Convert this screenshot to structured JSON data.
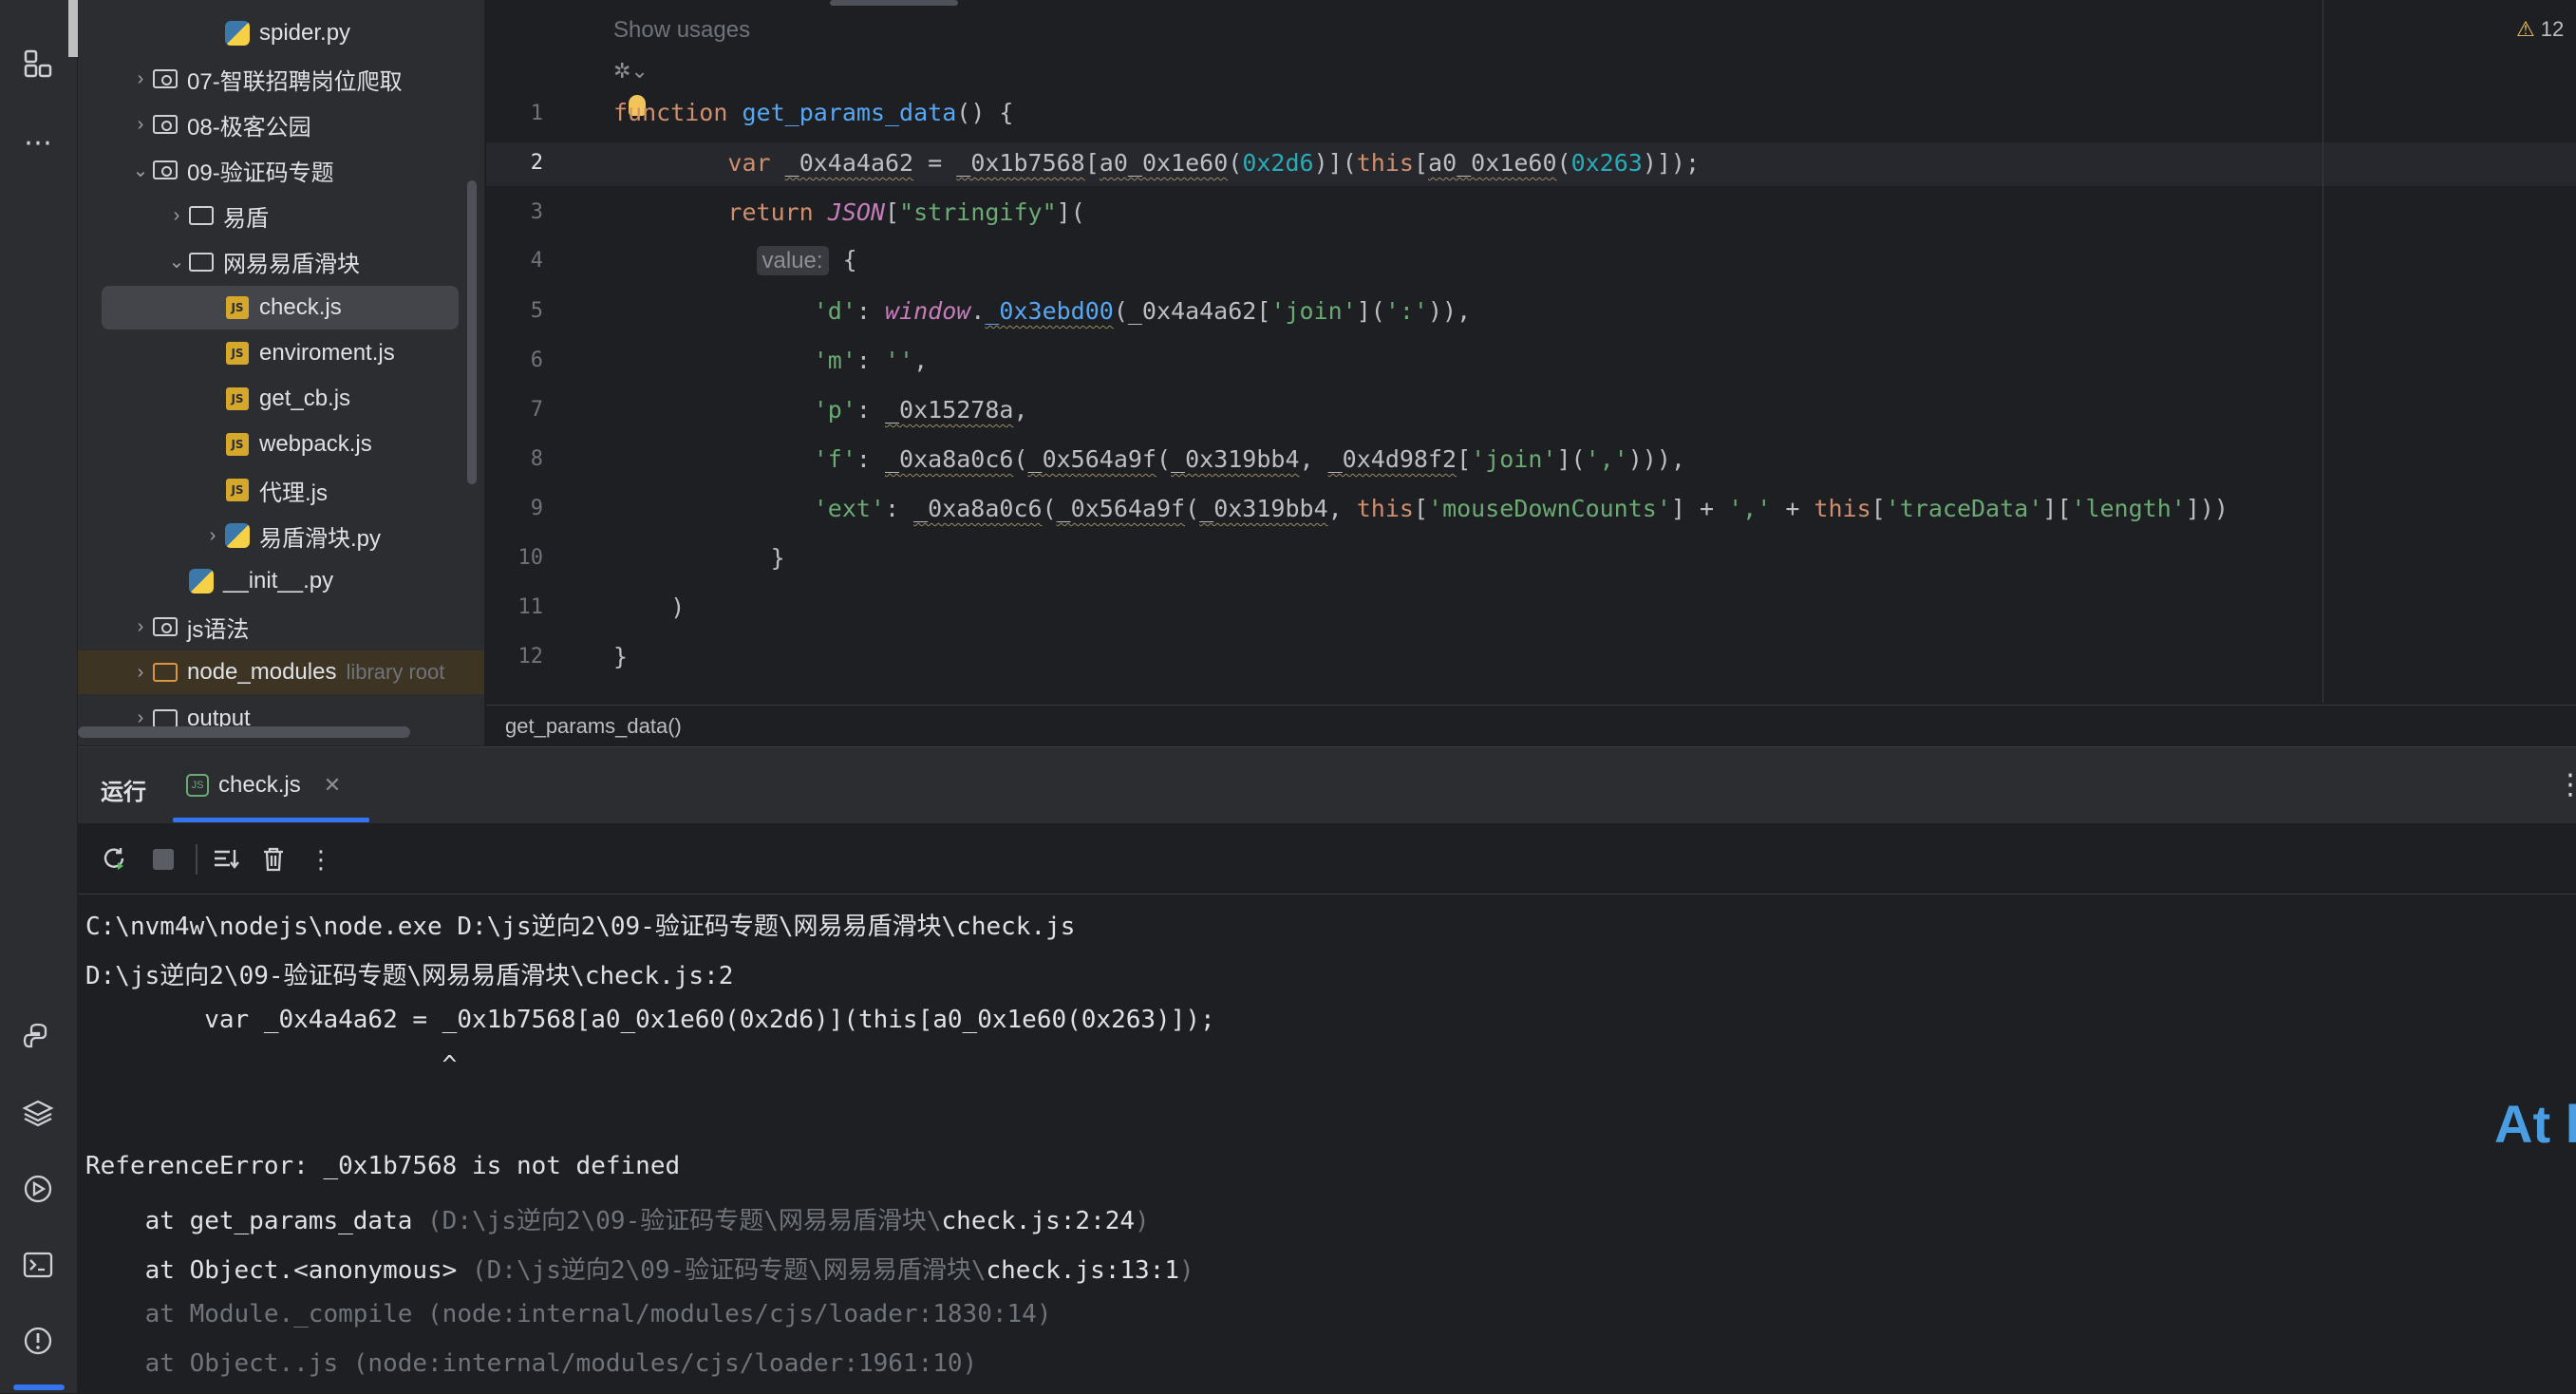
{
  "project_tree": [
    {
      "label": "spider.py",
      "type": "py",
      "indent": 3,
      "chevron": ""
    },
    {
      "label": "07-智联招聘岗位爬取",
      "type": "folder-mod",
      "indent": 1,
      "chevron": "›"
    },
    {
      "label": "08-极客公园",
      "type": "folder-mod",
      "indent": 1,
      "chevron": "›"
    },
    {
      "label": "09-验证码专题",
      "type": "folder-mod",
      "indent": 1,
      "chevron": "⌄"
    },
    {
      "label": "易盾",
      "type": "folder",
      "indent": 2,
      "chevron": "›"
    },
    {
      "label": "网易易盾滑块",
      "type": "folder",
      "indent": 2,
      "chevron": "⌄"
    },
    {
      "label": "check.js",
      "type": "js",
      "indent": 3,
      "chevron": "",
      "selected": true
    },
    {
      "label": "enviroment.js",
      "type": "js",
      "indent": 3,
      "chevron": ""
    },
    {
      "label": "get_cb.js",
      "type": "js",
      "indent": 3,
      "chevron": ""
    },
    {
      "label": "webpack.js",
      "type": "js",
      "indent": 3,
      "chevron": ""
    },
    {
      "label": "代理.js",
      "type": "js",
      "indent": 3,
      "chevron": ""
    },
    {
      "label": "易盾滑块.py",
      "type": "py",
      "indent": 3,
      "chevron": "›"
    },
    {
      "label": "__init__.py",
      "type": "py",
      "indent": 2,
      "chevron": ""
    },
    {
      "label": "js语法",
      "type": "folder-mod",
      "indent": 1,
      "chevron": "›"
    },
    {
      "label": "node_modules",
      "type": "folder-nm",
      "indent": 1,
      "chevron": "›",
      "suffix": "library root"
    },
    {
      "label": "output",
      "type": "folder",
      "indent": 1,
      "chevron": "›"
    }
  ],
  "editor": {
    "show_usages": "Show usages",
    "warning_count": "12",
    "value_hint": "value:",
    "line_numbers": [
      "1",
      "2",
      "3",
      "4",
      "5",
      "6",
      "7",
      "8",
      "9",
      "10",
      "11",
      "12"
    ],
    "breadcrumb": "get_params_data()"
  },
  "run_panel": {
    "title": "运行",
    "tab_label": "check.js",
    "output_lines": [
      "C:\\nvm4w\\nodejs\\node.exe D:\\js逆向2\\09-验证码专题\\网易易盾滑块\\check.js",
      "D:\\js逆向2\\09-验证码专题\\网易易盾滑块\\check.js:2",
      "        var _0x4a4a62 = _0x1b7568[a0_0x1e60(0x2d6)](this[a0_0x1e60(0x263)]);",
      "                        ^",
      "",
      "ReferenceError: _0x1b7568 is not defined"
    ],
    "stack": [
      {
        "prefix": "    at get_params_data ",
        "path": "(D:\\js逆向2\\09-验证码专题\\网易易盾滑块\\",
        "file": "check.js:2:24",
        "close": ")"
      },
      {
        "prefix": "    at Object.<anonymous> ",
        "path": "(D:\\js逆向2\\09-验证码专题\\网易易盾滑块\\",
        "file": "check.js:13:1",
        "close": ")"
      }
    ],
    "stack_dim": [
      "    at Module._compile (node:internal/modules/cjs/loader:1830:14)",
      "    at Object..js (node:internal/modules/cjs/loader:1961:10)"
    ],
    "overlay_text": "At l"
  },
  "colors": {
    "accent": "#3574f0",
    "keyword": "#cf8e6d",
    "function": "#56a8f5",
    "string": "#6aab73",
    "number": "#2aacb8"
  }
}
